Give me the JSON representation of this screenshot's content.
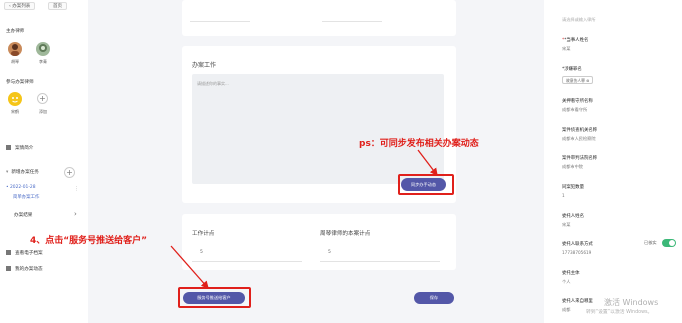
{
  "topbar": {
    "tabs": [
      "‹ 办案列表",
      "首页"
    ]
  },
  "sidebar": {
    "lead_lawyer_title": "主办律师",
    "lead_lawyers": [
      {
        "name": "胡琴"
      },
      {
        "name": "李青"
      }
    ],
    "co_lawyer_title": "参与办案律师",
    "co_lawyers": [
      {
        "name": "宋鹤"
      }
    ],
    "add_label": "添加",
    "case_intro": "案情简介",
    "new_task": "新增办案任务",
    "task_date": "2022-01-28",
    "task_name": "简单办案工作",
    "case_result": "办案结果",
    "chevron": "›",
    "view_files": "查看电子档案",
    "my_updates": "我的办案动态"
  },
  "main": {
    "top_field_left": "",
    "top_field_right": "",
    "work_title": "办案工作",
    "work_placeholder": "请描述你的事实...",
    "sync_button": "同步办手动态",
    "points_title": "工作计点",
    "points_value": "5",
    "this_case_title": "周琴律师的本案计点",
    "this_case_value": "5",
    "push_button": "服务号推送给客户",
    "save_button": "保存"
  },
  "right": {
    "top_hint": "请选择或输入律所",
    "fields": [
      {
        "label": "*当事人姓名",
        "value": "宋某"
      },
      {
        "label": "*涉嫌罪名",
        "value": ""
      },
      {
        "label": "关押看守所名称",
        "value": "成都市看守所"
      },
      {
        "label": "案件侦查机关名称",
        "value": "成都市人民检察院"
      },
      {
        "label": "案件审判法院名称",
        "value": "成都市中院"
      },
      {
        "label": "同案犯数量",
        "value": "1"
      },
      {
        "label": "委托人姓名",
        "value": "宋某"
      },
      {
        "label": "委托人联系方式",
        "value": "17738705619"
      },
      {
        "label": "委托主体",
        "value": "个人"
      },
      {
        "label": "委托人来自哪里",
        "value": "成都"
      }
    ],
    "crime_tag": "故意伤人罪",
    "crime_tag_close": "⊗",
    "verified_label": "已核实"
  },
  "annotations": {
    "ps_note": "ps：可同步发布相关办案动态",
    "step4_note": "4、点击“服务号推送给客户”"
  },
  "watermark": {
    "line1": "激活 Windows",
    "line2": "转到“设置”以激活 Windows。"
  },
  "colors": {
    "accent": "#5357a8",
    "annotation": "#e0201b",
    "toggle": "#3cb878",
    "background": "#f4f5f8"
  }
}
